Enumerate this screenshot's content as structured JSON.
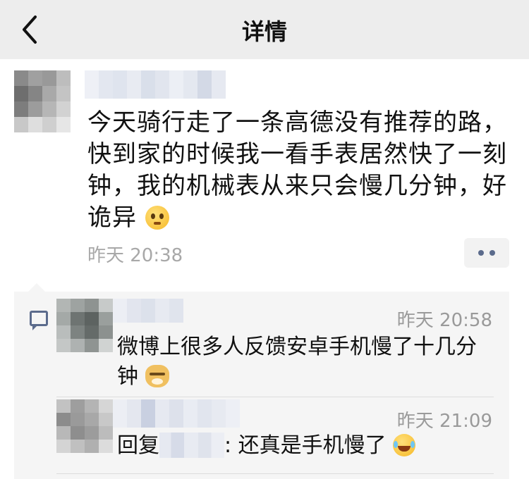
{
  "nav": {
    "title": "详情",
    "back_icon": "chevron-left-icon"
  },
  "post": {
    "text": "今天骑行走了一条高德没有推荐的路，快到家的时候我一看手表居然快了一刻钟，我的机械表从来只会慢几分钟，好诡异",
    "emoji": "woozy-face-emoji",
    "time": "昨天 20:38",
    "more_icon": "two-dots-icon"
  },
  "comments": [
    {
      "time": "昨天 20:58",
      "text": "微博上很多人反馈安卓手机慢了十几分钟",
      "emoji": "doge-emoji"
    },
    {
      "time": "昨天 21:09",
      "reply_prefix": "回复",
      "text": ": 还真是手机慢了",
      "emoji": "tears-of-joy-emoji"
    }
  ],
  "colors": {
    "nav_bg": "#ededed",
    "comments_bg": "#f5f5f5",
    "link_blue": "#5b6b8c",
    "time_gray": "#a8a8a8"
  }
}
